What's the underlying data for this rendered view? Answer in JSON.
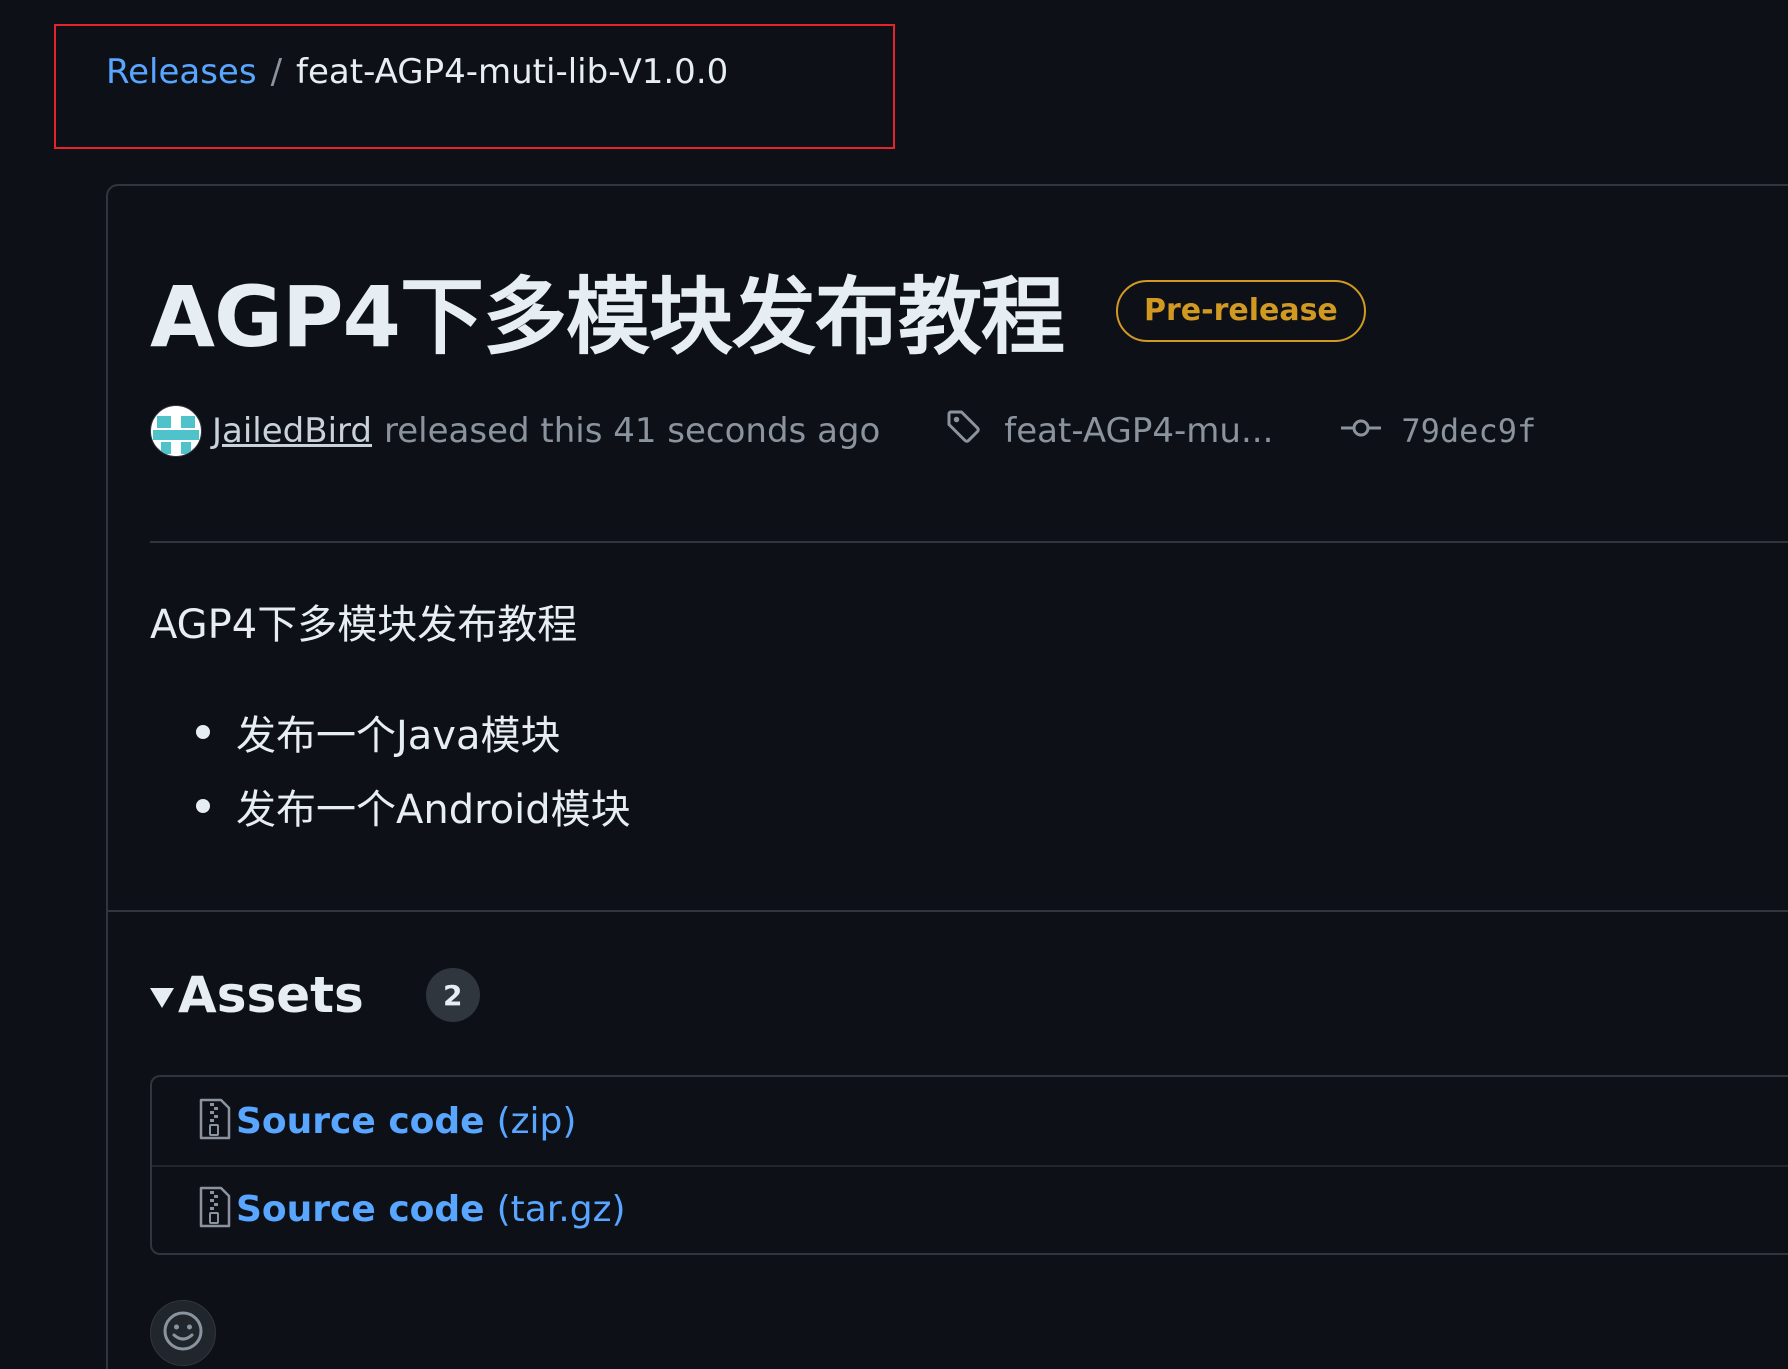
{
  "breadcrumb": {
    "releases_label": "Releases",
    "separator": "/",
    "current": "feat-AGP4-muti-lib-V1.0.0"
  },
  "release": {
    "title": "AGP4下多模块发布教程",
    "badge": "Pre-release",
    "author": "JailedBird",
    "released_text": "released this 41 seconds ago",
    "tag": "feat-AGP4-mu...",
    "commit": "79dec9f",
    "description": "AGP4下多模块发布教程",
    "bullets": [
      "发布一个Java模块",
      "发布一个Android模块"
    ]
  },
  "assets": {
    "label": "Assets",
    "count": "2",
    "items": [
      {
        "name": "Source code",
        "ext": "(zip)"
      },
      {
        "name": "Source code",
        "ext": "(tar.gz)"
      }
    ]
  },
  "colors": {
    "background": "#0d1117",
    "link": "#58a6ff",
    "prerelease": "#d29922",
    "highlight_box": "#e5232a"
  },
  "icons": [
    "tag-icon",
    "git-commit-icon",
    "file-zip-icon",
    "smiley-icon"
  ]
}
